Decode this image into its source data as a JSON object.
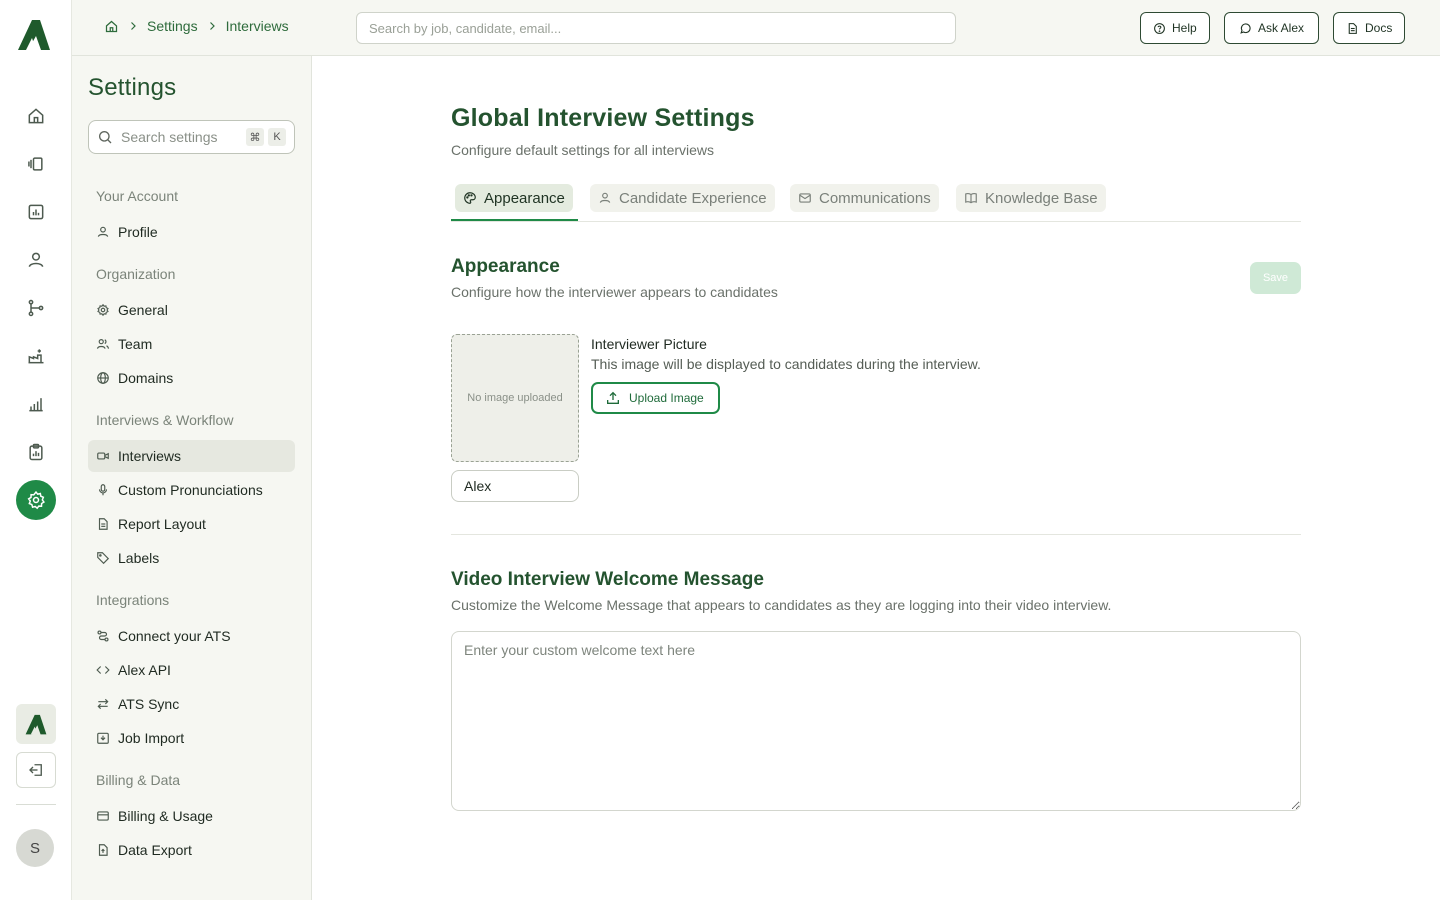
{
  "topbar": {
    "breadcrumb": [
      "Settings",
      "Interviews"
    ],
    "search_placeholder": "Search by job, candidate, email...",
    "buttons": [
      {
        "label": "Help",
        "icon": "help-circle-icon"
      },
      {
        "label": "Ask Alex",
        "icon": "message-circle-icon"
      },
      {
        "label": "Docs",
        "icon": "document-icon"
      }
    ]
  },
  "rail": {
    "items": [
      "home-icon",
      "layers-icon",
      "chart-icon",
      "user-icon",
      "git-branch-icon",
      "factory-icon",
      "bar-chart-icon",
      "clipboard-icon",
      "settings-icon"
    ],
    "active": "settings-icon",
    "avatar_initial": "S"
  },
  "sidebar": {
    "title": "Settings",
    "search_placeholder": "Search settings",
    "shortcut_keys": [
      "⌘",
      "K"
    ],
    "sections": [
      {
        "label": "Your Account",
        "items": [
          {
            "label": "Profile",
            "icon": "user-icon"
          }
        ]
      },
      {
        "label": "Organization",
        "items": [
          {
            "label": "General",
            "icon": "gear-icon"
          },
          {
            "label": "Team",
            "icon": "users-icon"
          },
          {
            "label": "Domains",
            "icon": "globe-icon"
          }
        ]
      },
      {
        "label": "Interviews & Workflow",
        "items": [
          {
            "label": "Interviews",
            "icon": "video-icon",
            "active": true
          },
          {
            "label": "Custom Pronunciations",
            "icon": "microphone-icon"
          },
          {
            "label": "Report Layout",
            "icon": "file-text-icon"
          },
          {
            "label": "Labels",
            "icon": "tag-icon"
          }
        ]
      },
      {
        "label": "Integrations",
        "items": [
          {
            "label": "Connect your ATS",
            "icon": "route-icon"
          },
          {
            "label": "Alex API",
            "icon": "code-icon"
          },
          {
            "label": "ATS Sync",
            "icon": "arrows-swap-icon"
          },
          {
            "label": "Job Import",
            "icon": "download-icon"
          }
        ]
      },
      {
        "label": "Billing & Data",
        "items": [
          {
            "label": "Billing & Usage",
            "icon": "credit-card-icon"
          },
          {
            "label": "Data Export",
            "icon": "file-export-icon"
          }
        ]
      }
    ]
  },
  "main": {
    "title": "Global Interview Settings",
    "subtitle": "Configure default settings for all interviews",
    "tabs": [
      {
        "label": "Appearance",
        "icon": "palette-icon",
        "active": true
      },
      {
        "label": "Candidate Experience",
        "icon": "user-icon"
      },
      {
        "label": "Communications",
        "icon": "mail-icon"
      },
      {
        "label": "Knowledge Base",
        "icon": "book-icon"
      }
    ],
    "appearance": {
      "title": "Appearance",
      "subtitle": "Configure how the interviewer appears to candidates",
      "save_label": "Save",
      "no_image_text": "No image uploaded",
      "interviewer_name": "Alex",
      "picture_label": "Interviewer Picture",
      "picture_help": "This image will be displayed to candidates during the interview.",
      "upload_label": "Upload Image"
    },
    "welcome": {
      "title": "Video Interview Welcome Message",
      "subtitle": "Customize the Welcome Message that appears to candidates as they are logging into their video interview.",
      "placeholder": "Enter your custom welcome text here"
    }
  },
  "colors": {
    "accent": "#1f8a47",
    "heading": "#24532f",
    "sidebar_bg": "#f6f7f2"
  }
}
